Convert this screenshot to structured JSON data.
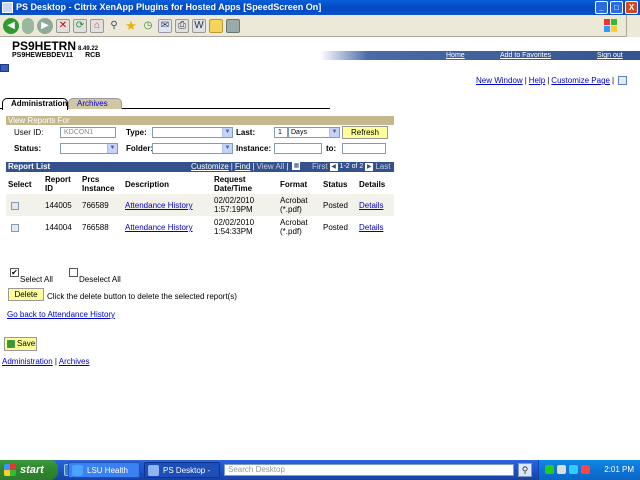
{
  "window": {
    "title": "PS Desktop - Citrix XenApp Plugins for Hosted Apps [SpeedScreen On]",
    "buttons": [
      "_",
      "□",
      "X"
    ]
  },
  "header": {
    "db_name": "PS9HETRN",
    "db_version": "8.49.22",
    "db_sub": "PS9HEWEBDEV11",
    "user": "RCB",
    "nav": {
      "home": "Home",
      "favorites": "Add to Favorites",
      "signout": "Sign out"
    }
  },
  "toplinks": {
    "new_window": "New Window",
    "help": "Help",
    "customize": "Customize Page"
  },
  "tabs": {
    "active": "Administration",
    "inactive": "Archives"
  },
  "view_reports": {
    "heading": "View Reports For",
    "user_id_label": "User ID:",
    "user_id_value": "KDCON1",
    "type_label": "Type:",
    "last_label": "Last:",
    "last_value": "1",
    "last_unit": "Days",
    "refresh": "Refresh",
    "status_label": "Status:",
    "folder_label": "Folder:",
    "instance_label": "Instance:",
    "to_label": "to:"
  },
  "report_list": {
    "heading": "Report List",
    "customize": "Customize",
    "find": "Find",
    "view_all": "View All",
    "first": "First",
    "range": "1-2 of 2",
    "last": "Last",
    "columns": {
      "select": "Select",
      "report_id": "Report ID",
      "prcs_instance": "Prcs Instance",
      "description": "Description",
      "request": "Request Date/Time",
      "format": "Format",
      "status": "Status",
      "details": "Details"
    },
    "rows": [
      {
        "report_id": "144005",
        "instance": "766589",
        "description": "Attendance History",
        "date": "02/02/2010",
        "time": "1:57:19PM",
        "format1": "Acrobat",
        "format2": "(*.pdf)",
        "status": "Posted",
        "details": "Details"
      },
      {
        "report_id": "144004",
        "instance": "766588",
        "description": "Attendance History",
        "date": "02/02/2010",
        "time": "1:54:33PM",
        "format1": "Acrobat",
        "format2": "(*.pdf)",
        "status": "Posted",
        "details": "Details"
      }
    ]
  },
  "actions": {
    "select_all": "Select All",
    "deselect_all": "Deselect All",
    "delete": "Delete",
    "delete_help": "Click the delete button to delete the selected report(s)",
    "go_back": "Go back to Attendance History",
    "save": "Save"
  },
  "footer_links": {
    "admin": "Administration",
    "archives": "Archives"
  },
  "taskbar": {
    "start": "start",
    "task1": "LSU Health Sci...",
    "task2": "PS Desktop - ...",
    "search_placeholder": "Search Desktop",
    "clock": "2:01 PM"
  }
}
